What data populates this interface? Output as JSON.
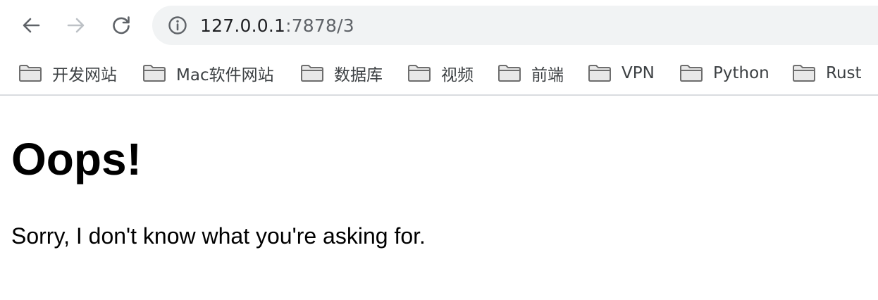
{
  "browser": {
    "address": {
      "host": "127.0.0.1",
      "rest": ":7878/3"
    },
    "bookmarks": [
      {
        "label": "开发网站"
      },
      {
        "label": "Mac软件网站"
      },
      {
        "label": "数据库"
      },
      {
        "label": "视频"
      },
      {
        "label": "前端"
      },
      {
        "label": "VPN"
      },
      {
        "label": "Python"
      },
      {
        "label": "Rust"
      }
    ]
  },
  "page": {
    "heading": "Oops!",
    "message": "Sorry, I don't know what you're asking for."
  },
  "icons": {
    "back": "arrow-left-icon",
    "forward": "arrow-right-icon",
    "reload": "reload-icon",
    "site_info": "info-icon",
    "bookmark_folder": "folder-icon"
  },
  "colors": {
    "omnibox_bg": "#f1f3f4",
    "url_host": "#202124",
    "url_rest": "#5f6368",
    "icon_active": "#5f6368",
    "icon_disabled": "#bdc1c6"
  }
}
